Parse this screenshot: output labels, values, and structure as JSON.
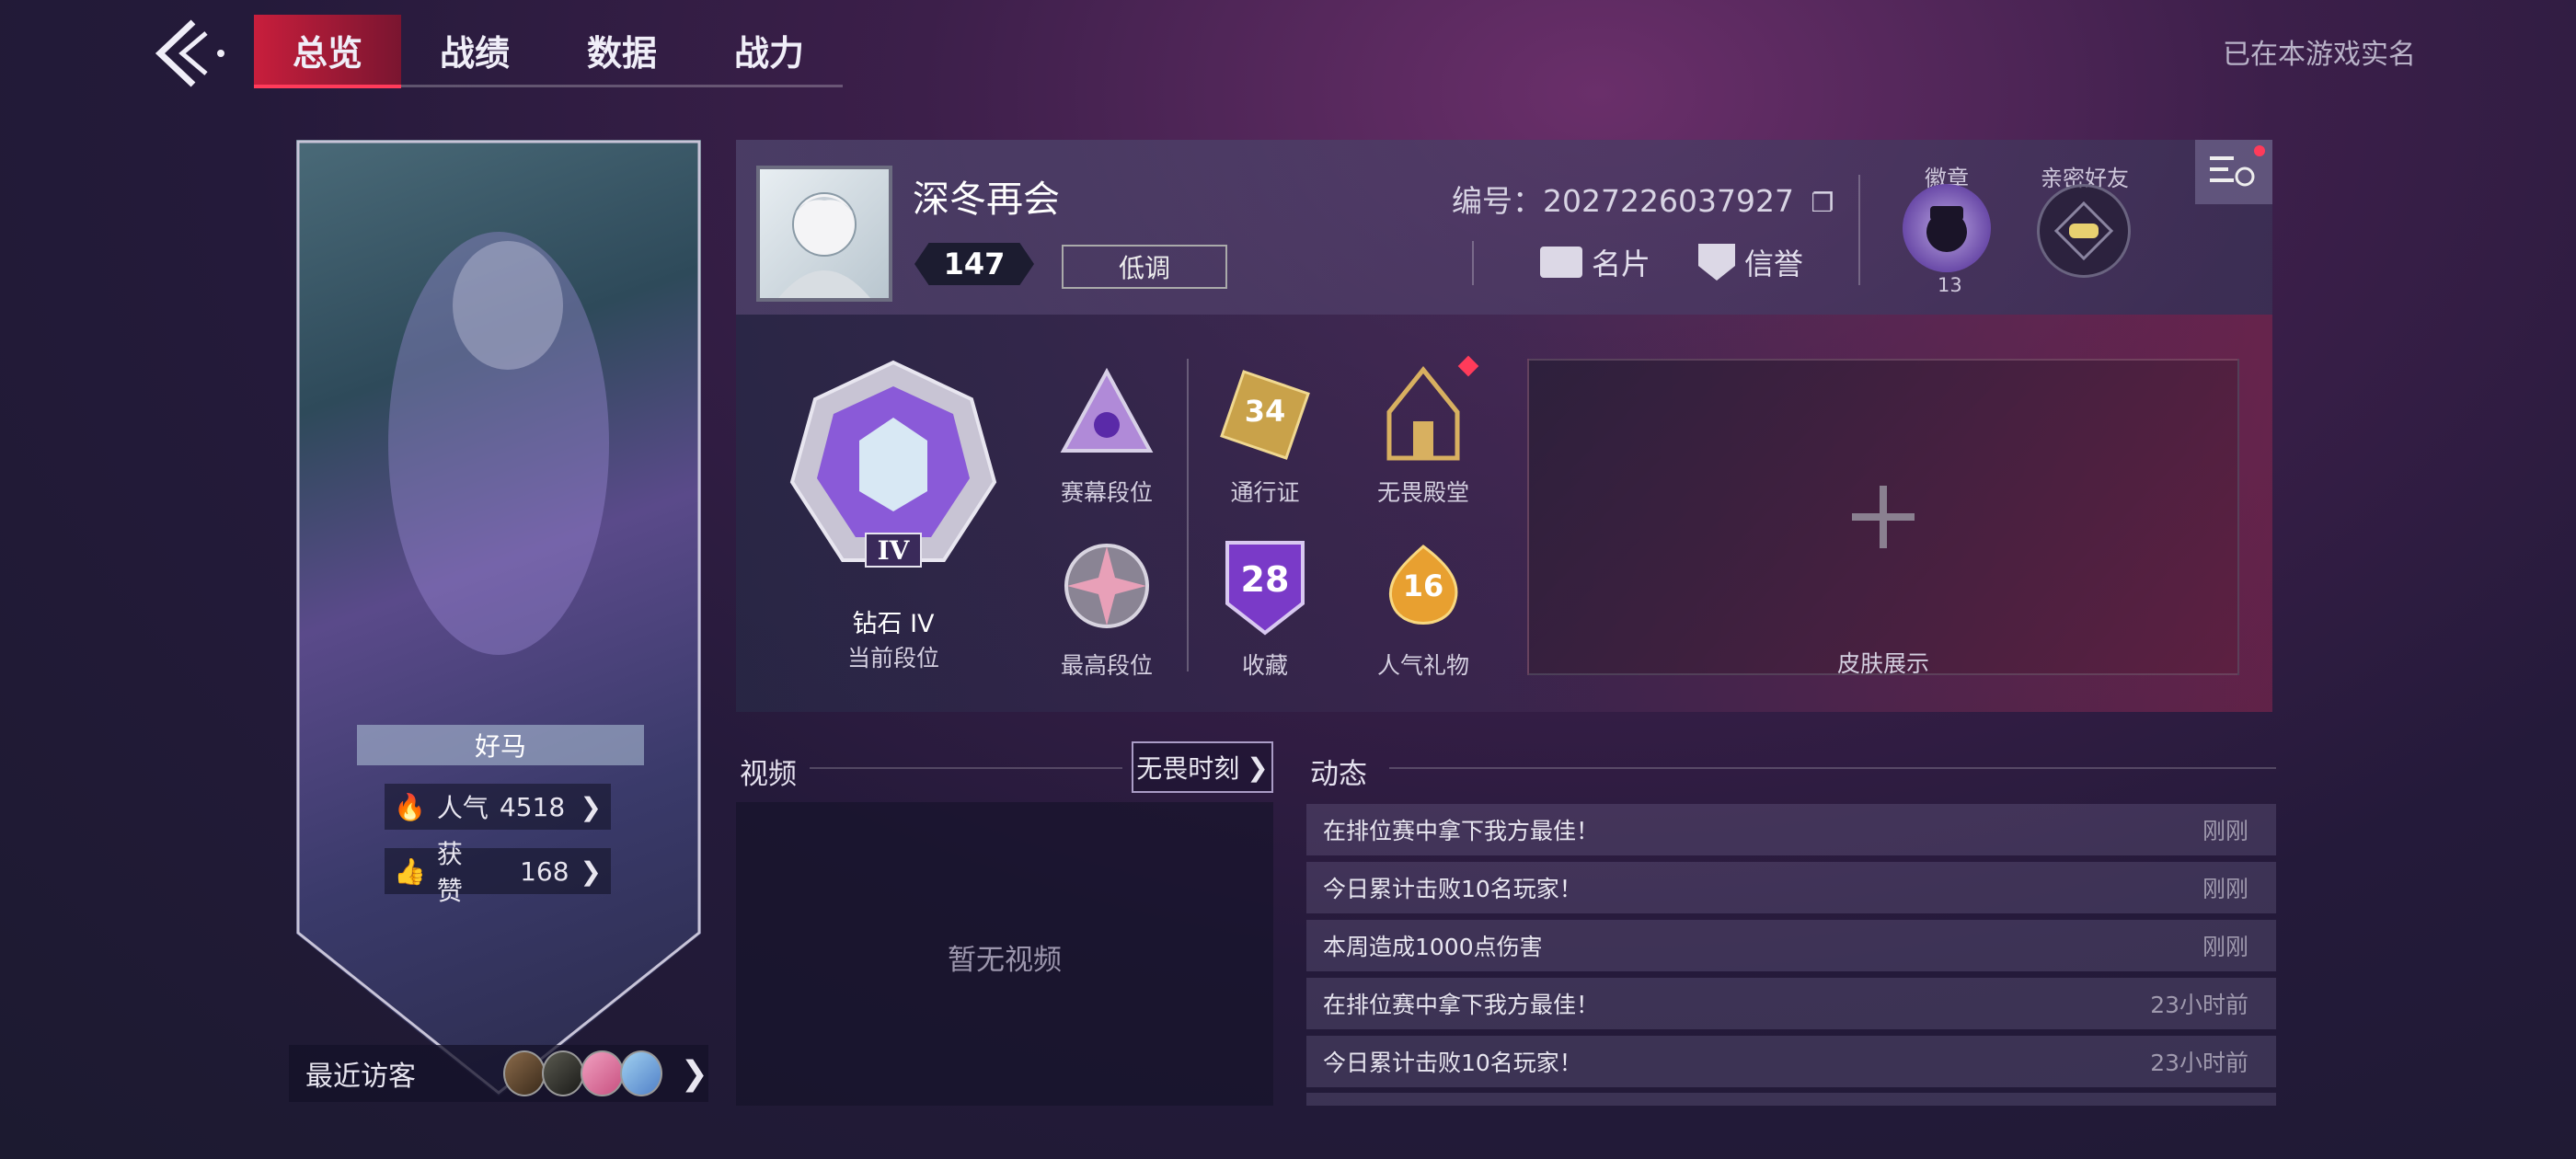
{
  "nav": {
    "tabs": [
      {
        "label": "总览",
        "active": true
      },
      {
        "label": "战绩",
        "active": false
      },
      {
        "label": "数据",
        "active": false
      },
      {
        "label": "战力",
        "active": false
      }
    ],
    "realname": "已在本游戏实名"
  },
  "hero": {
    "nickname": "好马",
    "popularity_label": "人气",
    "popularity_value": "4518",
    "likes_label": "获赞",
    "likes_value": "168"
  },
  "visitors": {
    "label": "最近访客",
    "count_shown": 4
  },
  "profile": {
    "name": "深冬再会",
    "level": "147",
    "status_btn": "低调",
    "id_text": "编号：2027226037927",
    "card_btn": "名片",
    "reputation_btn": "信誉",
    "badge_label": "徽章",
    "badge_count": "13",
    "friend_label": "亲密好友"
  },
  "ranks": {
    "current_tier": "钻石 IV",
    "current_label": "当前段位",
    "current_numeral": "IV",
    "season_label": "赛幕段位",
    "pass_label": "通行证",
    "pass_level": "34",
    "hall_label": "无畏殿堂",
    "highest_label": "最高段位",
    "collection_label": "收藏",
    "collection_count": "28",
    "gift_label": "人气礼物",
    "gift_count": "16",
    "skin_label": "皮肤展示"
  },
  "video": {
    "title": "视频",
    "button": "无畏时刻",
    "empty": "暂无视频"
  },
  "feed": {
    "title": "动态",
    "items": [
      {
        "text": "在排位赛中拿下我方最佳！",
        "time": "刚刚"
      },
      {
        "text": "今日累计击败10名玩家！",
        "time": "刚刚"
      },
      {
        "text": "本周造成1000点伤害",
        "time": "刚刚"
      },
      {
        "text": "在排位赛中拿下我方最佳！",
        "time": "23小时前"
      },
      {
        "text": "今日累计击败10名玩家！",
        "time": "23小时前"
      }
    ]
  },
  "colors": {
    "accent_red": "#c81e3c",
    "notify_dot": "#ff3b5a",
    "gold": "#e8c25a",
    "purple": "#9a6ae0"
  }
}
